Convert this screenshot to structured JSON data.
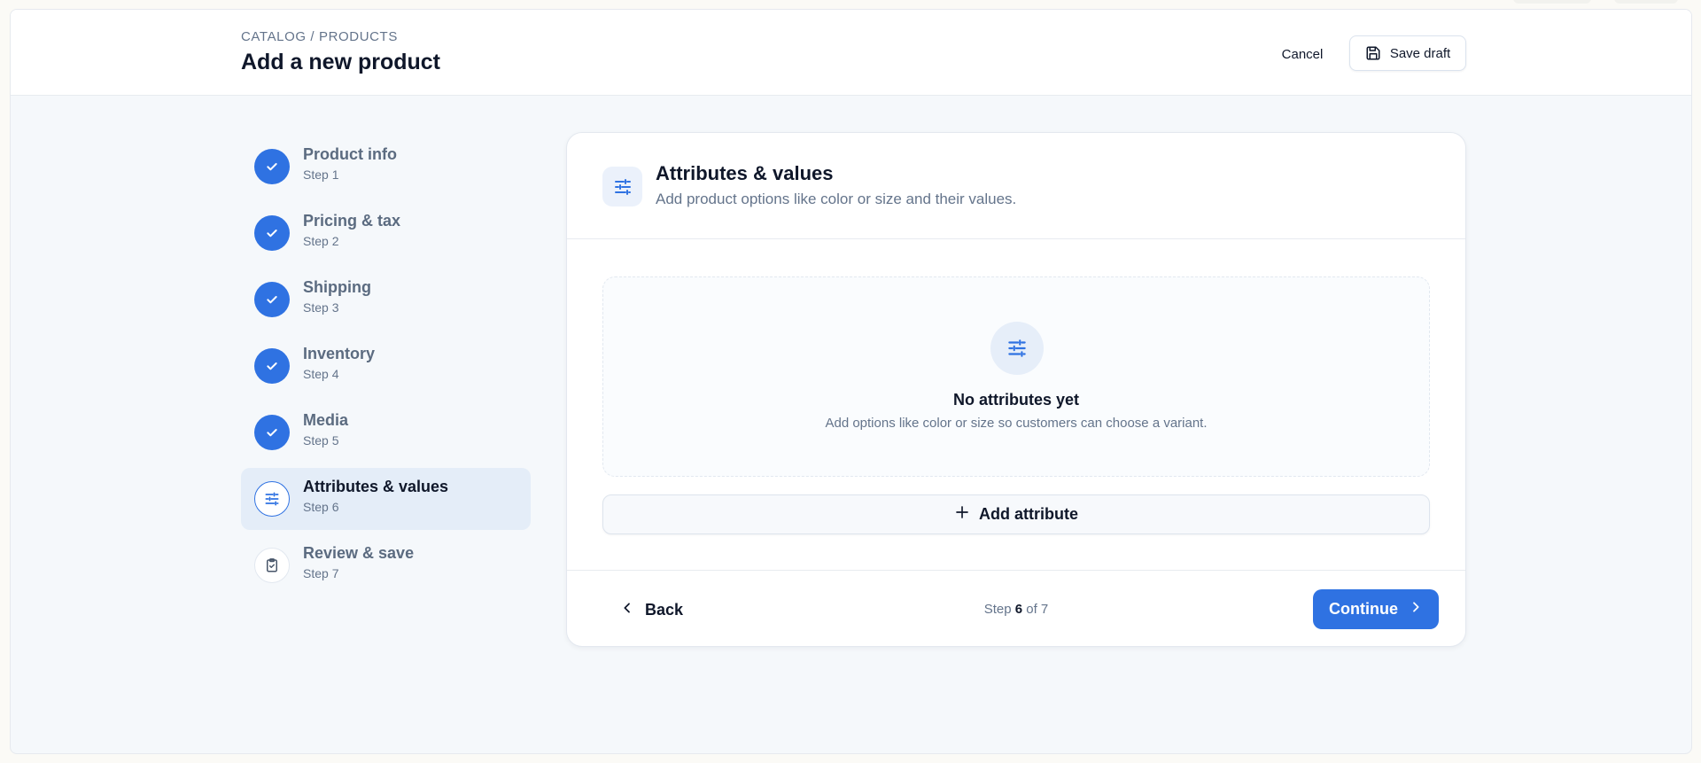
{
  "header": {
    "breadcrumb": "CATALOG / PRODUCTS",
    "title": "Add a new product",
    "cancel_label": "Cancel",
    "save_draft_label": "Save draft",
    "save_icon": "floppy-disk-icon"
  },
  "steps": [
    {
      "label": "Product info",
      "sub": "Step 1",
      "status": "done"
    },
    {
      "label": "Pricing & tax",
      "sub": "Step 2",
      "status": "done"
    },
    {
      "label": "Shipping",
      "sub": "Step 3",
      "status": "done"
    },
    {
      "label": "Inventory",
      "sub": "Step 4",
      "status": "done"
    },
    {
      "label": "Media",
      "sub": "Step 5",
      "status": "done"
    },
    {
      "label": "Attributes & values",
      "sub": "Step 6",
      "status": "current",
      "icon": "sliders-icon"
    },
    {
      "label": "Review & save",
      "sub": "Step 7",
      "status": "upcoming",
      "icon": "clipboard-check-icon"
    }
  ],
  "card": {
    "title": "Attributes & values",
    "subtitle": "Add product options like color or size and their values.",
    "icon": "sliders-icon",
    "empty_state": {
      "title": "No attributes yet",
      "subtitle": "Add options like color or size so customers can choose a variant."
    },
    "add_button_label": "Add attribute",
    "footer": {
      "back_label": "Back",
      "step_prefix": "Step",
      "step_current": "6",
      "step_suffix": "of 7",
      "continue_label": "Continue"
    }
  },
  "colors": {
    "accent": "#2f72e2",
    "active_step_bg": "#e4edf8",
    "page_bg": "#f5f8fb",
    "muted_text": "#64748b"
  }
}
